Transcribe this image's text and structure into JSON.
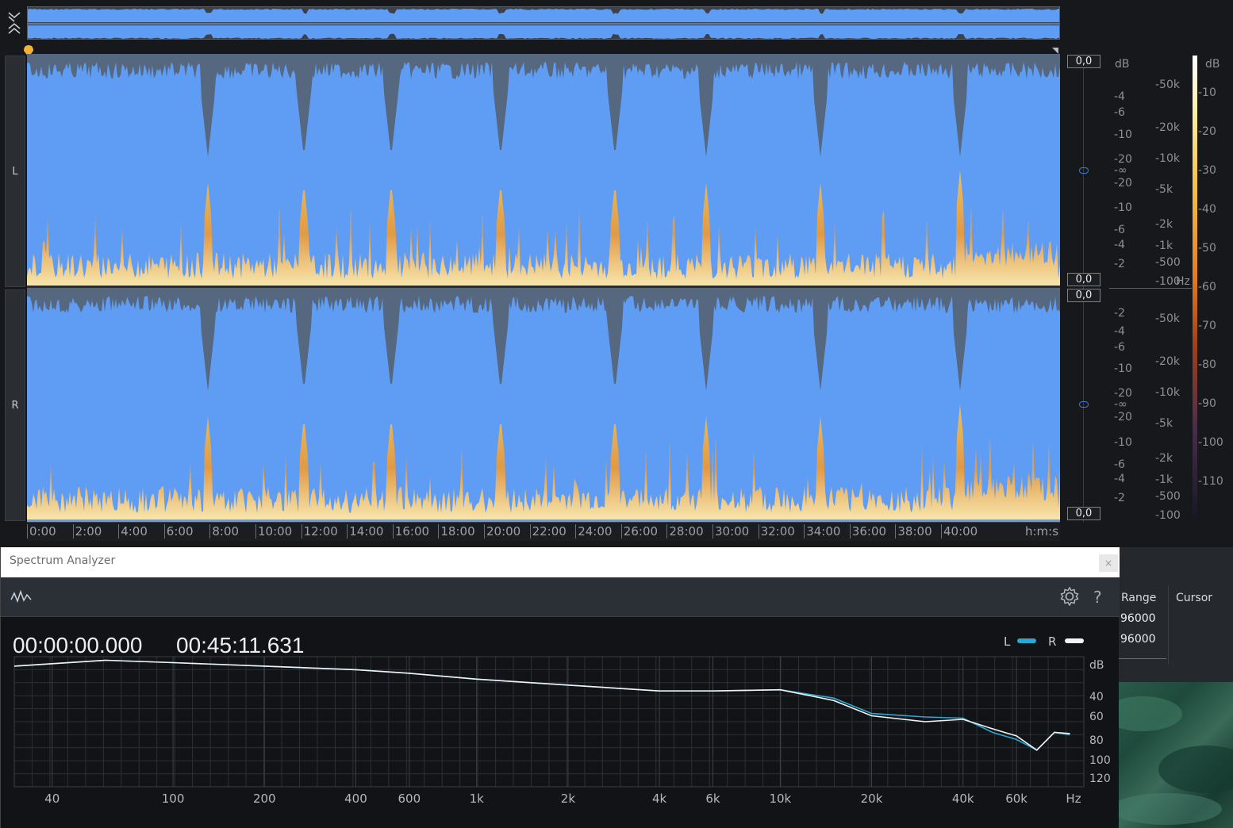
{
  "overview": {},
  "channels": {
    "left": "L",
    "right": "R"
  },
  "amplitude": {
    "boxes": [
      "0,0",
      "0,0",
      "0,0",
      "0,0"
    ],
    "db_label": "dB",
    "left_scale": [
      "-4",
      "-6",
      "-10",
      "-20",
      "-∞",
      "-20",
      "-10",
      "-6",
      "-4",
      "-2"
    ],
    "right_scale": [
      "-2",
      "-4",
      "-6",
      "-10",
      "-20",
      "-∞",
      "-20",
      "-10",
      "-6",
      "-4",
      "-2"
    ]
  },
  "frequency": {
    "top_scale": [
      "50k",
      "20k",
      "10k",
      "5k",
      "2k",
      "1k",
      "500",
      "100"
    ],
    "bottom_scale": [
      "50k",
      "20k",
      "10k",
      "5k",
      "2k",
      "1k",
      "500",
      "100"
    ],
    "unit": "Hz"
  },
  "colorbar": {
    "label": "dB",
    "ticks": [
      "10",
      "20",
      "30",
      "40",
      "50",
      "60",
      "70",
      "80",
      "90",
      "100",
      "110"
    ]
  },
  "ruler": {
    "ticks": [
      "0:00",
      "2:00",
      "4:00",
      "6:00",
      "8:00",
      "10:00",
      "12:00",
      "14:00",
      "16:00",
      "18:00",
      "20:00",
      "22:00",
      "24:00",
      "26:00",
      "28:00",
      "30:00",
      "32:00",
      "34:00",
      "36:00",
      "38:00",
      "40:00"
    ],
    "unit": "h:m:s"
  },
  "spectrum_analyzer": {
    "title": "Spectrum Analyzer",
    "close": "×",
    "help": "?",
    "time_start": "00:00:00.000",
    "time_end": "00:45:11.631",
    "legend": {
      "left": "L",
      "right": "R",
      "left_color": "#2aa8d4",
      "right_color": "#f0f2f4"
    },
    "db_label": "dB",
    "db_ticks": [
      "40",
      "60",
      "80",
      "100",
      "120"
    ],
    "freq_ticks": [
      "40",
      "100",
      "200",
      "400",
      "600",
      "1k",
      "2k",
      "4k",
      "6k",
      "10k",
      "20k",
      "40k",
      "60k"
    ],
    "freq_unit": "Hz"
  },
  "right_panel": {
    "range_label": "Range",
    "cursor_label": "Cursor",
    "values": [
      "96000",
      "96000"
    ]
  },
  "chart_data": {
    "type": "line",
    "xlabel": "Hz",
    "ylabel": "dB",
    "x_scale": "log",
    "xlim": [
      30,
      100000
    ],
    "ylim": [
      130,
      20
    ],
    "grid": true,
    "legend": "top-right",
    "series": [
      {
        "name": "L",
        "color": "#2aa8d4",
        "x": [
          30,
          60,
          100,
          200,
          400,
          600,
          1000,
          2000,
          4000,
          6000,
          10000,
          15000,
          20000,
          30000,
          40000,
          50000,
          60000,
          70000,
          80000,
          90000
        ],
        "y": [
          28,
          23,
          25,
          28,
          31,
          34,
          39,
          44,
          49,
          49,
          48,
          55,
          68,
          71,
          72,
          84,
          90,
          99,
          84,
          86
        ]
      },
      {
        "name": "R",
        "color": "#f0f2f4",
        "x": [
          30,
          60,
          100,
          200,
          400,
          600,
          1000,
          2000,
          4000,
          6000,
          10000,
          15000,
          20000,
          30000,
          40000,
          50000,
          60000,
          70000,
          80000,
          90000
        ],
        "y": [
          28,
          23,
          25,
          28,
          31,
          34,
          39,
          44,
          49,
          49,
          48,
          57,
          70,
          75,
          73,
          81,
          87,
          99,
          84,
          85
        ]
      }
    ]
  }
}
